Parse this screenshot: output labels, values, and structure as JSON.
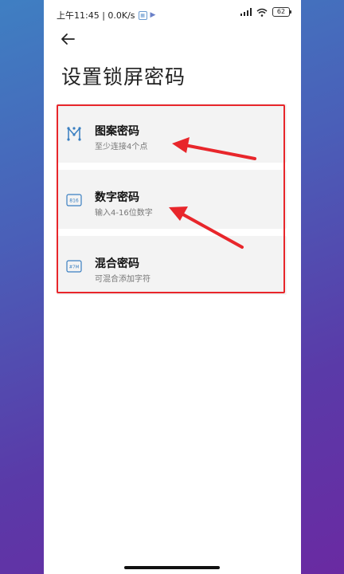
{
  "status": {
    "time_speed": "上午11:45 | 0.0K/s",
    "battery": "62"
  },
  "page": {
    "title": "设置锁屏密码"
  },
  "options": [
    {
      "title": "图案密码",
      "subtitle": "至少连接4个点",
      "icon": "pattern-icon"
    },
    {
      "title": "数字密码",
      "subtitle": "输入4-16位数字",
      "icon": "numeric-icon",
      "icon_text": "816"
    },
    {
      "title": "混合密码",
      "subtitle": "可混合添加字符",
      "icon": "mixed-icon",
      "icon_text": "#7M"
    }
  ],
  "colors": {
    "accent": "#3a7fc1",
    "annotation": "#e8262b"
  }
}
